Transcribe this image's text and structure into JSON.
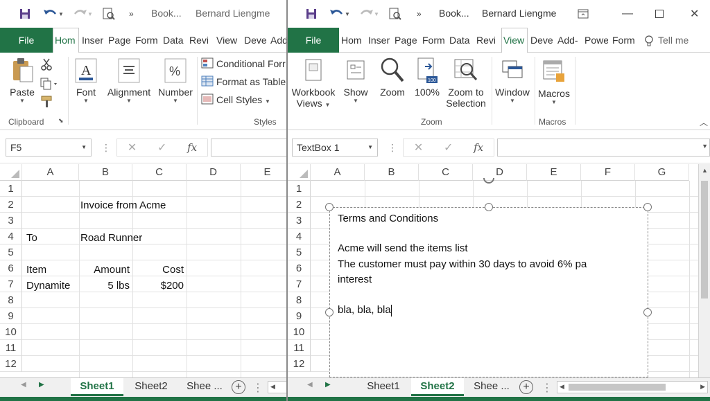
{
  "left": {
    "title": {
      "book": "Book...",
      "user": "Bernard Liengme"
    },
    "tabs": [
      "File",
      "Hom",
      "Inser",
      "Page",
      "Form",
      "Data",
      "Revi",
      "View",
      "Deve",
      "Add"
    ],
    "ribbon": {
      "paste": "Paste",
      "font": "Font",
      "alignment": "Alignment",
      "number": "Number",
      "conditional": "Conditional Forr",
      "format_table": "Format as Table",
      "cell_styles": "Cell Styles",
      "clipboard": "Clipboard",
      "styles": "Styles"
    },
    "namebox": "F5",
    "columns": [
      "A",
      "B",
      "C",
      "D",
      "E"
    ],
    "rows": [
      "1",
      "2",
      "3",
      "4",
      "5",
      "6",
      "7",
      "8",
      "9",
      "10",
      "11",
      "12"
    ],
    "cells": {
      "b2": "Invoice from Acme",
      "a4": "To",
      "b4": "Road Runner",
      "a6": "Item",
      "b6": "Amount",
      "c6": "Cost",
      "a7": "Dynamite",
      "b7": "5 lbs",
      "c7": "$200"
    },
    "sheets": [
      "Sheet1",
      "Sheet2",
      "Shee ..."
    ]
  },
  "right": {
    "title": {
      "book": "Book...",
      "user": "Bernard Liengme"
    },
    "tabs": [
      "File",
      "Hom",
      "Inser",
      "Page",
      "Form",
      "Data",
      "Revi",
      "View",
      "Deve",
      "Add-",
      "Powe",
      "Form",
      "Tell me"
    ],
    "ribbon": {
      "workbook_views": "Workbook",
      "workbook_views2": "Views",
      "show": "Show",
      "zoom": "Zoom",
      "zoom100": "100%",
      "zoom_sel": "Zoom to",
      "zoom_sel2": "Selection",
      "window": "Window",
      "macros": "Macros",
      "grp_zoom": "Zoom",
      "grp_macros": "Macros"
    },
    "namebox": "TextBox 1",
    "columns": [
      "A",
      "B",
      "C",
      "D",
      "E",
      "F",
      "G"
    ],
    "rows": [
      "1",
      "2",
      "3",
      "4",
      "5",
      "6",
      "7",
      "8",
      "9",
      "10",
      "11",
      "12"
    ],
    "textbox": {
      "line1": "Terms and Conditions",
      "line2": "Acme will send the items list",
      "line3": "The customer must pay within 30 days to avoid 6% pa",
      "line4": "interest",
      "line5": "bla, bla, bla"
    },
    "sheets": [
      "Sheet1",
      "Sheet2",
      "Shee ..."
    ]
  },
  "colors": {
    "accent": "#217346"
  }
}
